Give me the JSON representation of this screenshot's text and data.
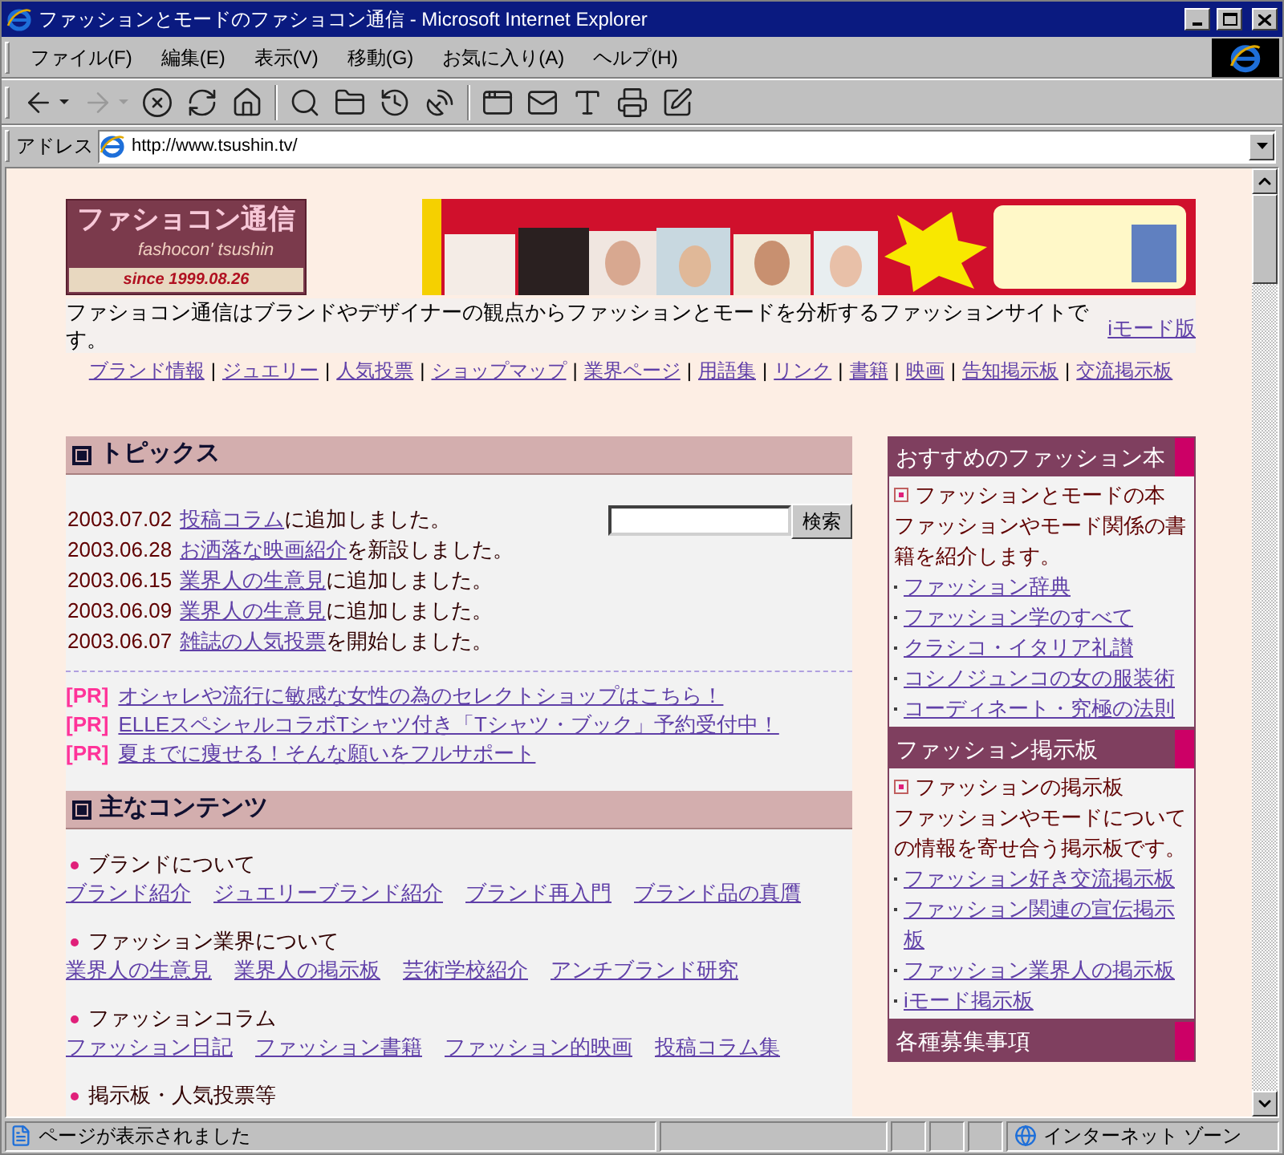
{
  "window": {
    "title": "ファッションとモードのファショコン通信 - Microsoft Internet Explorer"
  },
  "menu": [
    "ファイル(F)",
    "編集(E)",
    "表示(V)",
    "移動(G)",
    "お気に入り(A)",
    "ヘルプ(H)"
  ],
  "toolbar": [
    {
      "kind": "back",
      "disabled": false
    },
    {
      "kind": "forward",
      "disabled": true
    },
    {
      "kind": "stop",
      "disabled": false
    },
    {
      "kind": "refresh",
      "disabled": false
    },
    {
      "kind": "home",
      "disabled": false
    },
    {
      "kind": "search",
      "disabled": false
    },
    {
      "kind": "favorites",
      "disabled": false
    },
    {
      "kind": "history",
      "disabled": false
    },
    {
      "kind": "channels",
      "disabled": false
    },
    {
      "kind": "fullscreen",
      "disabled": false
    },
    {
      "kind": "mail",
      "disabled": false
    },
    {
      "kind": "font",
      "disabled": false
    },
    {
      "kind": "print",
      "disabled": false
    },
    {
      "kind": "edit",
      "disabled": false
    }
  ],
  "address": {
    "label": "アドレス",
    "value": "http://www.tsushin.tv/"
  },
  "page": {
    "logo": {
      "title": "ファショコン通信",
      "subtitle": "fashocon' tsushin",
      "since": "since 1999.08.26"
    },
    "intro": "ファショコン通信はブランドやデザイナーの観点からファッションとモードを分析するファッションサイトです。",
    "imode_link": "iモード版",
    "nav": [
      {
        "label": "ブランド情報",
        "separator": "|"
      },
      {
        "label": "ジュエリー",
        "separator": "|"
      },
      {
        "label": "人気投票",
        "separator": "|"
      },
      {
        "label": "ショップマップ",
        "separator": "|"
      },
      {
        "label": "業界ページ",
        "separator": "|"
      },
      {
        "label": "用語集",
        "separator": "|"
      },
      {
        "label": "リンク",
        "separator": "|"
      },
      {
        "label": "書籍",
        "separator": "|"
      },
      {
        "label": "映画",
        "separator": "|"
      },
      {
        "label": "告知掲示板",
        "separator": "|"
      },
      {
        "label": "交流掲示板"
      }
    ],
    "topics": {
      "title": "トピックス",
      "items": [
        {
          "date": "2003.07.02",
          "link": "投稿コラム",
          "text": "に追加しました。"
        },
        {
          "date": "2003.06.28",
          "link": "お洒落な映画紹介",
          "text": "を新設しました。"
        },
        {
          "date": "2003.06.15",
          "link": "業界人の生意見",
          "text": "に追加しました。"
        },
        {
          "date": "2003.06.09",
          "link": "業界人の生意見",
          "text": "に追加しました。"
        },
        {
          "date": "2003.06.07",
          "link": "雑誌の人気投票",
          "text": "を開始しました。"
        }
      ],
      "search": {
        "button": "検索"
      },
      "pr": [
        {
          "tag": "[PR]",
          "text": "オシャレや流行に敏感な女性の為のセレクトショップはこちら！"
        },
        {
          "tag": "[PR]",
          "text": "ELLEスペシャルコラボTシャツ付き「Tシャツ・ブック」予約受付中！"
        },
        {
          "tag": "[PR]",
          "text": "夏までに痩せる！そんな願いをフルサポート"
        }
      ]
    },
    "contents": {
      "title": "主なコンテンツ",
      "sections": [
        {
          "heading": "ブランドについて",
          "links": [
            "ブランド紹介",
            "ジュエリーブランド紹介",
            "ブランド再入門",
            "ブランド品の真贋"
          ]
        },
        {
          "heading": "ファッション業界について",
          "links": [
            "業界人の生意見",
            "業界人の掲示板",
            "芸術学校紹介",
            "アンチブランド研究"
          ]
        },
        {
          "heading": "ファッションコラム",
          "links": [
            "ファッション日記",
            "ファッション書籍",
            "ファッション的映画",
            "投稿コラム集"
          ]
        },
        {
          "heading": "掲示板・人気投票等"
        }
      ]
    },
    "sidebar": [
      {
        "title": "おすすめのファッション本",
        "lead": "ファッションとモードの本",
        "description": "ファッションやモード関係の書籍を紹介します。",
        "links": [
          "ファッション辞典",
          "ファッション学のすべて",
          "クラシコ・イタリア礼讃",
          "コシノジュンコの女の服装術",
          "コーディネート・究極の法則"
        ]
      },
      {
        "title": "ファッション掲示板",
        "lead": "ファッションの掲示板",
        "description": "ファッションやモードについての情報を寄せ合う掲示板です。",
        "links": [
          "ファッション好き交流掲示板",
          "ファッション関連の宣伝掲示板",
          "ファッション業界人の掲示板",
          "iモード掲示板"
        ]
      },
      {
        "title": "各種募集事項"
      }
    ]
  },
  "status_bar": {
    "text": "ページが表示されました",
    "zone": "インターネット ゾーン"
  }
}
